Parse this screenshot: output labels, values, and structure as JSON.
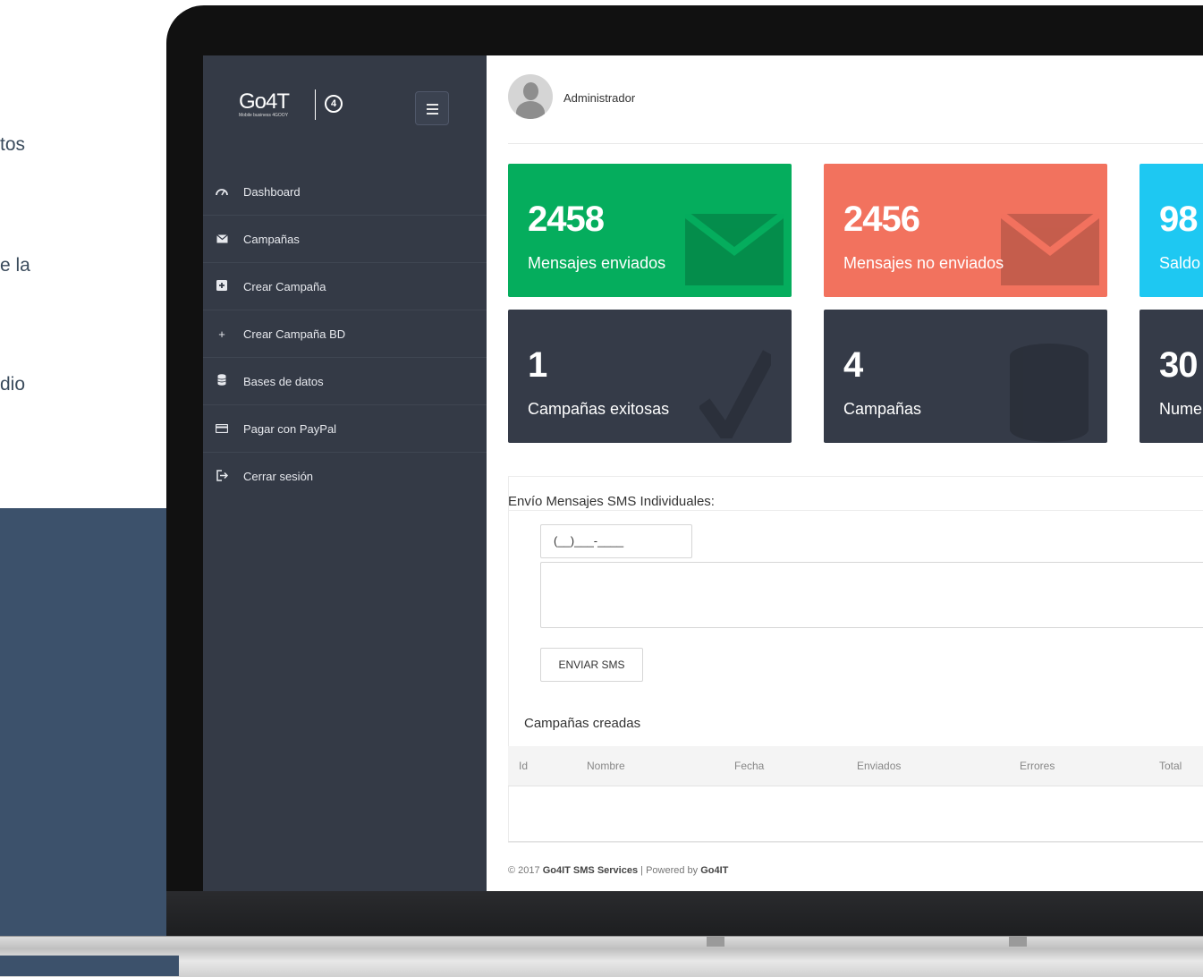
{
  "background": {
    "text_fragments": [
      "tos",
      "e  la",
      "dio"
    ]
  },
  "sidebar": {
    "logo_text": "Go4T",
    "logo_sub": "Mobile business 4GOOY",
    "globe_icon": "globe-icon",
    "menu_icon": "hamburger-icon",
    "items": [
      {
        "label": "Dashboard",
        "icon": "dashboard-icon"
      },
      {
        "label": "Campañas",
        "icon": "envelope-icon"
      },
      {
        "label": "Crear Campaña",
        "icon": "plus-square-icon"
      },
      {
        "label": "Crear Campaña BD",
        "icon": "plus-icon"
      },
      {
        "label": "Bases de datos",
        "icon": "database-icon"
      },
      {
        "label": "Pagar con PayPal",
        "icon": "credit-card-icon"
      },
      {
        "label": "Cerrar sesión",
        "icon": "sign-out-icon"
      }
    ]
  },
  "header": {
    "user_name": "Administrador"
  },
  "stats": [
    {
      "value": "2458",
      "label": "Mensajes enviados",
      "color": "#05ad5d",
      "icon": "envelope-icon"
    },
    {
      "value": "2456",
      "label": "Mensajes no enviados",
      "color": "#f2725e",
      "icon": "envelope-icon"
    },
    {
      "value": "98",
      "label": "Saldo",
      "color": "#1ec8f2",
      "icon": ""
    },
    {
      "value": "1",
      "label": "Campañas exitosas",
      "color": "#353b48",
      "icon": "check-icon"
    },
    {
      "value": "4",
      "label": "Campañas",
      "color": "#353b48",
      "icon": "database-icon"
    },
    {
      "value": "30",
      "label": "Nume",
      "color": "#353b48",
      "icon": ""
    }
  ],
  "sms": {
    "title": "Envío Mensajes SMS Individuales:",
    "phone_placeholder": "(__)___-____",
    "send_label": "ENVIAR SMS"
  },
  "campaigns": {
    "title": "Campañas creadas",
    "columns": [
      "Id",
      "Nombre",
      "Fecha",
      "Enviados",
      "Errores",
      "Total"
    ]
  },
  "footer": {
    "copyright": "© 2017",
    "company": "Go4IT SMS Services",
    "powered": "| Powered by",
    "brand": "Go4IT"
  }
}
